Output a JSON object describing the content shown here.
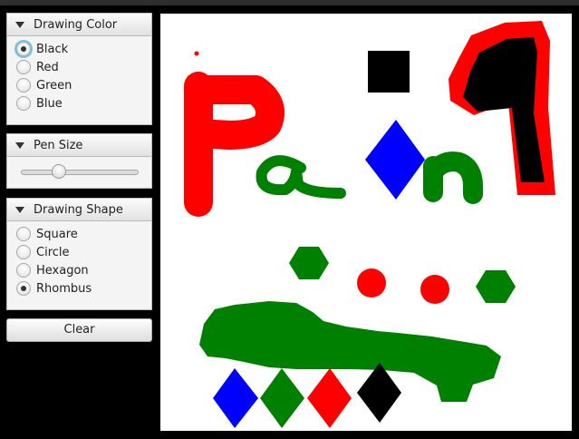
{
  "drawing_color": {
    "title": "Drawing Color",
    "options": [
      "Black",
      "Red",
      "Green",
      "Blue"
    ],
    "selected": "Black"
  },
  "pen_size": {
    "title": "Pen Size",
    "value_fraction": 0.33
  },
  "drawing_shape": {
    "title": "Drawing Shape",
    "options": [
      "Square",
      "Circle",
      "Hexagon",
      "Rhombus"
    ],
    "selected": "Rhombus"
  },
  "clear_button": {
    "label": "Clear"
  },
  "colors": {
    "red": "#ff0000",
    "green": "#008000",
    "blue": "#0000ff",
    "black": "#000000",
    "focus_ring": "#6fc3ea"
  }
}
